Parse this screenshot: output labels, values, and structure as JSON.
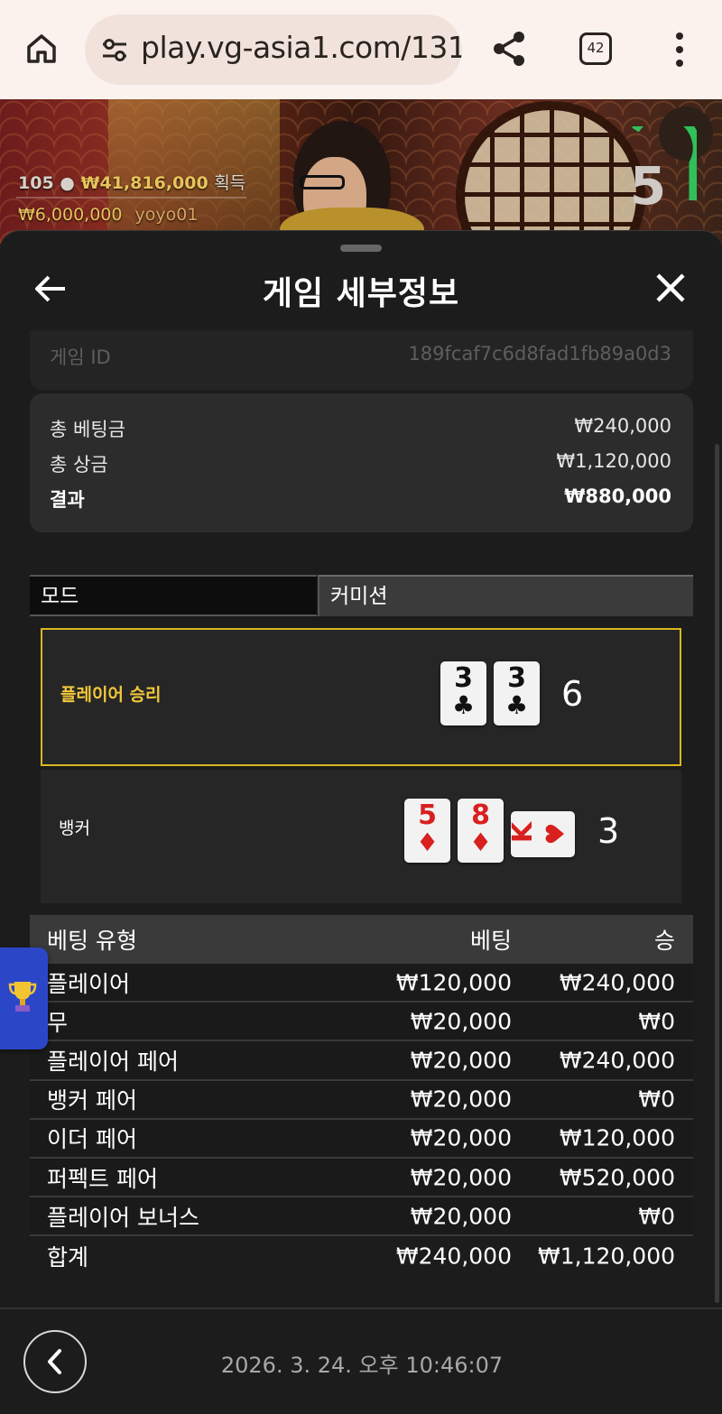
{
  "browser": {
    "url": "play.vg-asia1.com/131",
    "tab_count": "42"
  },
  "video": {
    "viewer_count": "105",
    "winnings": "₩41,816,000",
    "winnings_suffix": "획득",
    "top_bet_amount": "₩6,000,000",
    "top_bet_user": "yoyo01",
    "countdown": "5"
  },
  "sheet": {
    "title": "게임 세부정보",
    "game_id_label": "게임 ID",
    "game_id_value": "189fcaf7c6d8fad1fb89a0d3",
    "summary": {
      "total_bet_label": "총 베팅금",
      "total_bet_value": "₩240,000",
      "total_prize_label": "총 상금",
      "total_prize_value": "₩1,120,000",
      "result_label": "결과",
      "result_value": "₩880,000"
    },
    "mode_tabs": [
      "모드",
      "커미션"
    ],
    "player_hand": {
      "label": "플레이어 승리",
      "score": "6",
      "cards": [
        {
          "rank": "3",
          "suit": "♣",
          "color": "black"
        },
        {
          "rank": "3",
          "suit": "♣",
          "color": "black"
        }
      ]
    },
    "banker_hand": {
      "label": "뱅커",
      "score": "3",
      "cards": [
        {
          "rank": "5",
          "suit": "♦",
          "color": "red"
        },
        {
          "rank": "8",
          "suit": "♦",
          "color": "red"
        },
        {
          "rank": "K",
          "suit": "♥",
          "color": "red"
        }
      ]
    },
    "bet_table": {
      "headers": [
        "베팅 유형",
        "베팅",
        "승"
      ],
      "rows": [
        {
          "type": "플레이어",
          "bet": "₩120,000",
          "win": "₩240,000"
        },
        {
          "type": "무",
          "bet": "₩20,000",
          "win": "₩0"
        },
        {
          "type": "플레이어 페어",
          "bet": "₩20,000",
          "win": "₩240,000"
        },
        {
          "type": "뱅커 페어",
          "bet": "₩20,000",
          "win": "₩0"
        },
        {
          "type": "이더 페어",
          "bet": "₩20,000",
          "win": "₩120,000"
        },
        {
          "type": "퍼펙트 페어",
          "bet": "₩20,000",
          "win": "₩520,000"
        },
        {
          "type": "플레이어 보너스",
          "bet": "₩20,000",
          "win": "₩0"
        }
      ],
      "total": {
        "type": "합계",
        "bet": "₩240,000",
        "win": "₩1,120,000"
      }
    },
    "timestamp": "2026. 3. 24. 오후 10:46:07"
  },
  "icons": {
    "home": "home-icon",
    "site_info": "tune-icon",
    "share": "share-icon",
    "menu": "more-vertical-icon",
    "back": "arrow-left-icon",
    "close": "close-icon",
    "footer_back": "chevron-left-icon",
    "trophy": "trophy-icon"
  },
  "colors": {
    "accent_gold": "#d9b81f",
    "winnings_gold": "#e8c35a",
    "timer_green": "#2fc05a",
    "card_red": "#d8201f",
    "trophy_tab_blue": "#2c46c8"
  }
}
